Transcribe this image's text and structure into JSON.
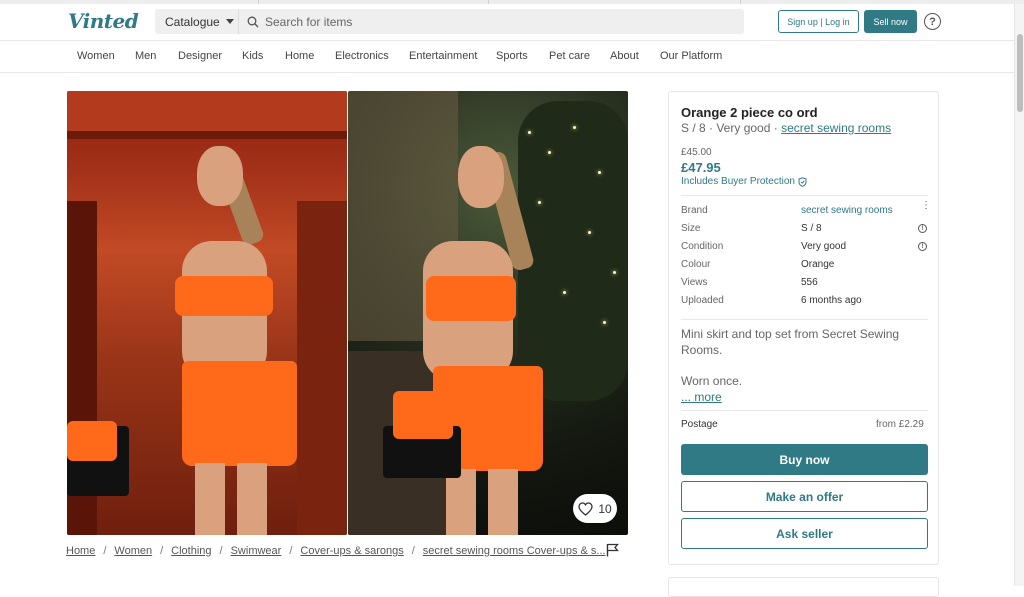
{
  "header": {
    "logo": "Vinted",
    "catalogue_label": "Catalogue",
    "search_placeholder": "Search for items",
    "auth_label": "Sign up | Log in",
    "sell_label": "Sell now",
    "help_label": "?"
  },
  "nav": {
    "items": [
      "Women",
      "Men",
      "Designer",
      "Kids",
      "Home",
      "Electronics",
      "Entertainment",
      "Sports",
      "Pet care",
      "About",
      "Our Platform"
    ]
  },
  "gallery": {
    "favourites_count": "10"
  },
  "breadcrumb": {
    "items": [
      "Home",
      "Women",
      "Clothing",
      "Swimwear",
      "Cover-ups & sarongs",
      "secret sewing rooms Cover-ups & s..."
    ]
  },
  "item": {
    "title": "Orange 2 piece co ord",
    "size_condition": "S / 8 · Very good · ",
    "brand_link": "secret sewing rooms",
    "price_original": "£45.00",
    "price_total": "£47.95",
    "buyer_protection": "Includes Buyer Protection",
    "details": [
      {
        "label": "Brand",
        "value": "secret sewing rooms"
      },
      {
        "label": "Size",
        "value": "S / 8"
      },
      {
        "label": "Condition",
        "value": "Very good"
      },
      {
        "label": "Colour",
        "value": "Orange"
      },
      {
        "label": "Views",
        "value": "556"
      },
      {
        "label": "Uploaded",
        "value": "6 months ago"
      }
    ],
    "description_1": "Mini skirt and top set from Secret Sewing Rooms.",
    "description_2": "Worn once.",
    "more_label": "... more",
    "postage_label": "Postage",
    "postage_value": "from £2.29",
    "buy_now": "Buy now",
    "make_offer": "Make an offer",
    "ask_seller": "Ask seller"
  },
  "colors": {
    "brand": "#2f7a84",
    "outfit": "#ff6a1a"
  }
}
